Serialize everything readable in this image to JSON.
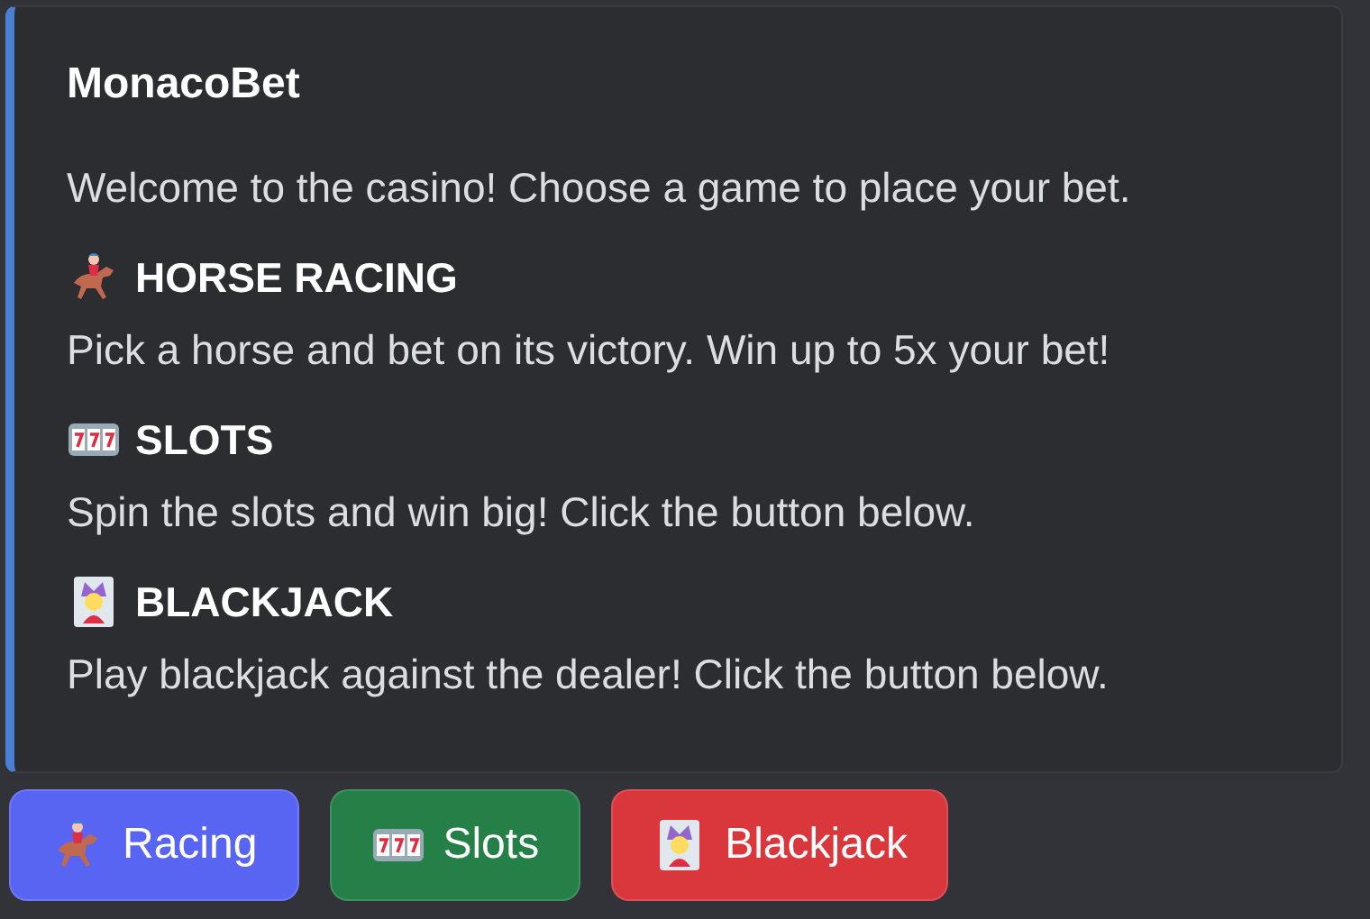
{
  "embed": {
    "title": "MonacoBet",
    "description": "Welcome to the casino! Choose a game to place your bet.",
    "games": [
      {
        "kind": "horse",
        "title": "HORSE RACING",
        "description": "Pick a horse and bet on its victory. Win up to 5x your bet!"
      },
      {
        "kind": "slots",
        "title": "SLOTS",
        "description": "Spin the slots and win big! Click the button below."
      },
      {
        "kind": "joker",
        "title": "BLACKJACK",
        "description": "Play blackjack against the dealer! Click the button below."
      }
    ]
  },
  "buttons": [
    {
      "kind": "horse",
      "label": "Racing",
      "color": "#5865f2"
    },
    {
      "kind": "slots",
      "label": "Slots",
      "color": "#248046"
    },
    {
      "kind": "joker",
      "label": "Blackjack",
      "color": "#da373c"
    }
  ]
}
